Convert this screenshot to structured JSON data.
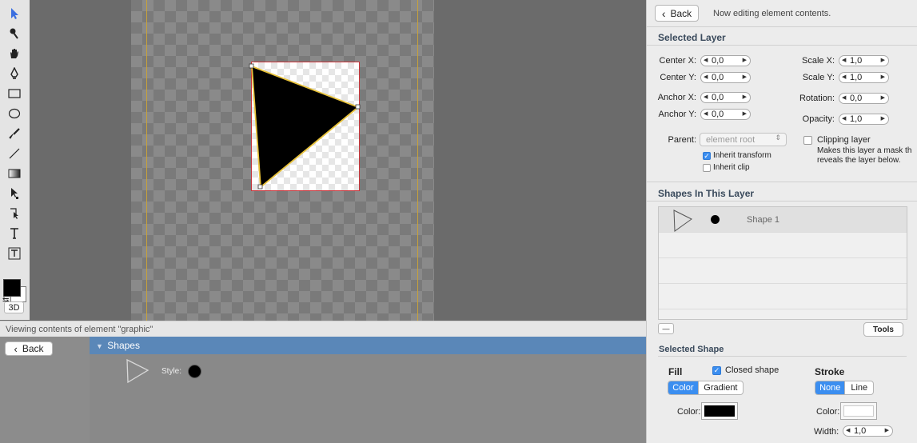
{
  "toolbar": {
    "tools": [
      "select-arrow",
      "brush-tool",
      "hand-tool",
      "pen-tool",
      "rectangle-tool",
      "ellipse-tool",
      "paintbrush-tool",
      "line-tool",
      "gradient-tool",
      "direct-select-tool",
      "convert-anchor-tool",
      "text-tool",
      "text-box-tool"
    ],
    "fill_color": "#000000",
    "stroke_color": "#ffffff",
    "three_d_label": "3D"
  },
  "status": {
    "text": "Viewing contents of element \"graphic\""
  },
  "bottom": {
    "back_label": "Back",
    "shapes_header": "Shapes",
    "style_label": "Style:"
  },
  "panel": {
    "back_label": "Back",
    "editing_note": "Now editing element contents.",
    "selected_layer_title": "Selected Layer",
    "center_x_label": "Center X:",
    "center_x": "0,0",
    "center_y_label": "Center Y:",
    "center_y": "0,0",
    "anchor_x_label": "Anchor X:",
    "anchor_x": "0,0",
    "anchor_y_label": "Anchor Y:",
    "anchor_y": "0,0",
    "scale_x_label": "Scale X:",
    "scale_x": "1,0",
    "scale_y_label": "Scale Y:",
    "scale_y": "1,0",
    "rotation_label": "Rotation:",
    "rotation": "0,0",
    "opacity_label": "Opacity:",
    "opacity": "1,0",
    "parent_label": "Parent:",
    "parent_value": "element root",
    "inherit_transform": "Inherit transform",
    "inherit_clip": "Inherit clip",
    "clipping_layer": "Clipping layer",
    "clipping_note_1": "Makes this layer a mask th",
    "clipping_note_2": "reveals the layer below.",
    "shapes_title": "Shapes In This Layer",
    "shapes": [
      {
        "name": "Shape 1"
      }
    ],
    "minus_label": "—",
    "tools_label": "Tools",
    "selected_shape_title": "Selected Shape",
    "fill_title": "Fill",
    "closed_shape": "Closed shape",
    "stroke_title": "Stroke",
    "fill_modes": [
      "Color",
      "Gradient"
    ],
    "stroke_modes": [
      "None",
      "Line"
    ],
    "fill_color_label": "Color:",
    "fill_color": "#000000",
    "stroke_color_label": "Color:",
    "stroke_color": "#ffffff",
    "width_label": "Width:",
    "width": "1,0"
  }
}
